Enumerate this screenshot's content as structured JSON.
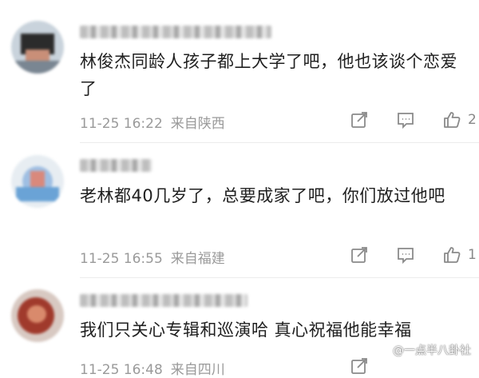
{
  "comments": [
    {
      "text": "林俊杰同龄人孩子都上大学了吧，他也该谈个恋爱了",
      "date": "11-25 16:22",
      "location": "来自陕西",
      "likes": "2"
    },
    {
      "text": "老林都40几岁了，总要成家了吧，你们放过他吧",
      "date": "11-25 16:55",
      "location": "来自福建",
      "likes": "1"
    },
    {
      "text": "我们只关心专辑和巡演哈 真心祝福他能幸福",
      "date": "11-25 16:48",
      "location": "来自四川",
      "likes": ""
    }
  ],
  "watermark": {
    "prefix": "@",
    "name": "一点半八卦社"
  },
  "colors": {
    "text": "#202020",
    "meta": "#9a9a9a",
    "icon": "#8a8a8a",
    "divider": "#ececec"
  }
}
